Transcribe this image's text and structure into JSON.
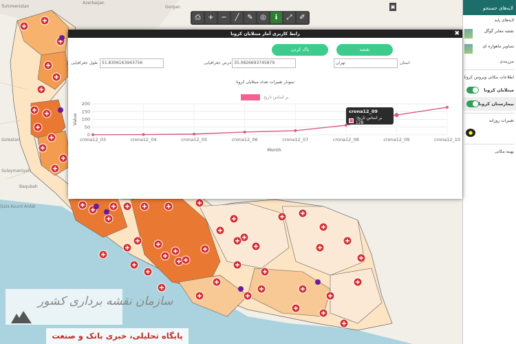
{
  "map_labels": [
    "Turkmenistan",
    "Azerbaijan",
    "Gorgan",
    "Golestan",
    "Sulaymaniyah",
    "Baqubah",
    "Qala Kourd Ardat"
  ],
  "toolbar": {
    "tools": [
      "print-icon",
      "zoom-in-icon",
      "zoom-out-icon",
      "draw-line-icon",
      "edit-icon",
      "layers-icon",
      "info-icon",
      "fullscreen-icon",
      "ruler-icon"
    ]
  },
  "panel": {
    "header": "لایه‌های جستجو",
    "items": [
      "لایه‌های پایه",
      "نقشه معابر گوگل",
      "تصاویر ماهواره ای",
      "مرزبندی",
      "اطلاعات مکانی ویروس کرونا"
    ],
    "toggles": [
      "مبتلایان کرونا",
      "بیمارستان کرونا"
    ],
    "items2": [
      "تغییرات روزانه",
      "بهینه مکانی"
    ]
  },
  "modal": {
    "title": "رابط کاربری آمار مبتلایان کرونا",
    "close": "✖",
    "btn_map": "نقشه",
    "btn_clear": "پاک کردن",
    "province_label": "استان",
    "province_value": "تهران",
    "lat_label": "عرض جغرافیایی",
    "lat_value": "35.0826693745879",
    "lon_label": "طول جغرافیایی",
    "lon_value": "51.8306163943756",
    "tooltip": {
      "title": "crona12_09",
      "line": "بر اساس تاریخ: 128"
    }
  },
  "watermark": {
    "org": "سازمان نقشه برداری کشور",
    "site": "پایگاه تحلیلی، خبری بانک و صنعت"
  },
  "colors": {
    "modal_button": "#3ecc8d",
    "series": "#d45c86",
    "panel_header": "#1b6e6a"
  },
  "chart_data": {
    "type": "line",
    "title": "نمودار تغییرات تعداد مبتلایان کرونا",
    "xlabel": "Month",
    "ylabel": "Value",
    "x": [
      "crona12_03",
      "crona12_04",
      "crona12_05",
      "crona12_06",
      "crona12_07",
      "crona12_08",
      "crona12_09",
      "crona12_10"
    ],
    "series": [
      {
        "name": "بر اساس تاریخ",
        "values": [
          1,
          2,
          5,
          18,
          27,
          62,
          128,
          178
        ]
      }
    ],
    "ylim": [
      0,
      200
    ],
    "yticks": [
      0,
      50,
      100,
      150,
      200
    ],
    "grid": true,
    "legend": "top"
  }
}
